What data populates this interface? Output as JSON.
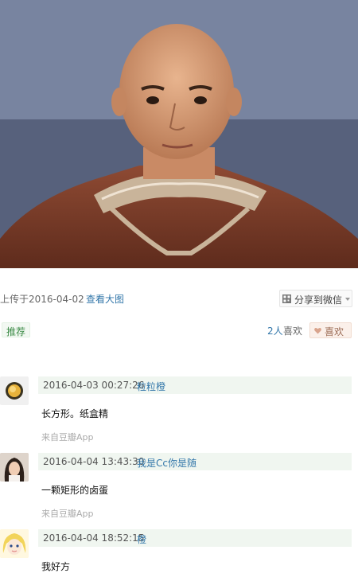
{
  "photo": {
    "icon": "portrait-photo"
  },
  "meta": {
    "upload_text": "上传于2016-04-02",
    "view_large": "查看大图",
    "share_label": "分享到微信"
  },
  "reactions": {
    "recommend_label": "推荐",
    "like_count": "2人",
    "like_suffix": "喜欢",
    "like_button": "喜欢"
  },
  "comments": [
    {
      "time": "2016-04-03 00:27:26",
      "user": "粒粒橙",
      "text": "长方形。纸盒精",
      "source": "来自豆瓣App"
    },
    {
      "time": "2016-04-04 13:43:30",
      "user": "我是Cc你是随",
      "text": "一颗矩形的卤蛋",
      "source": "来自豆瓣App"
    },
    {
      "time": "2016-04-04 18:52:15",
      "user": "橙",
      "text": "我好方"
    }
  ],
  "colors": {
    "link": "#3377aa",
    "accent_green": "#3d8c48",
    "header_bg": "#f0f6f0"
  }
}
